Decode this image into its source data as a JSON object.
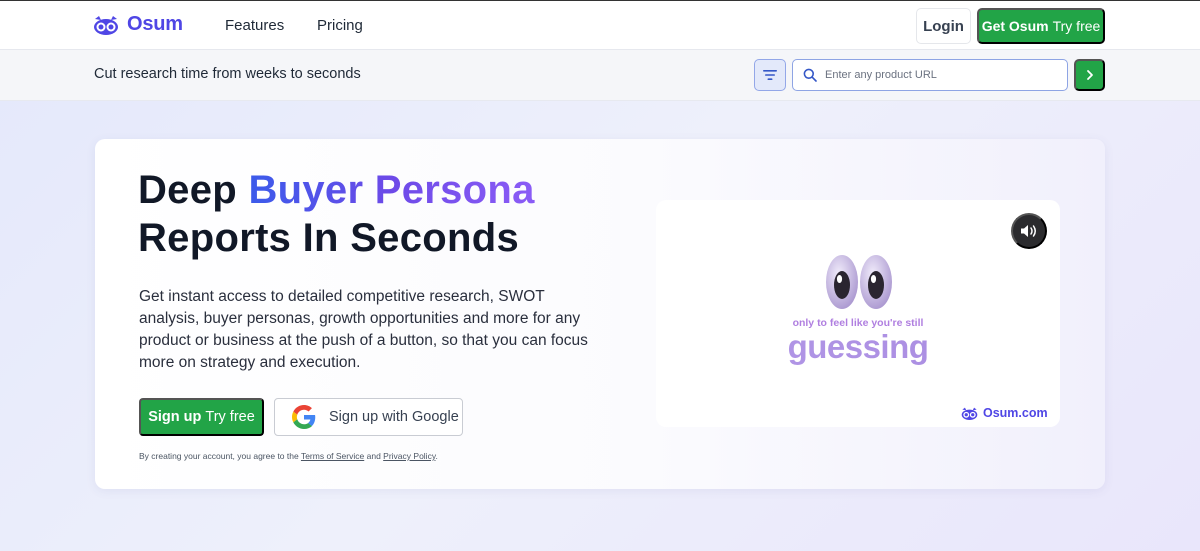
{
  "nav": {
    "brand": "Osum",
    "links": [
      "Features",
      "Pricing"
    ],
    "login_label": "Login",
    "cta_bold": "Get Osum",
    "cta_rest": "Try free"
  },
  "search": {
    "tagline": "Cut research time from weeks to seconds",
    "placeholder": "Enter any product URL"
  },
  "hero": {
    "headline_lead": "Deep",
    "headline_accent": "Buyer Persona",
    "headline_line2": "Reports In Seconds",
    "description": "Get instant access to detailed competitive research, SWOT analysis, buyer personas, growth opportunities and more for any product or business at the push of a button, so that you can focus more on strategy and execution.",
    "signup_bold": "Sign up",
    "signup_rest": "Try free",
    "google_label": "Sign up with Google",
    "legal_prefix": "By creating your account, you agree to the",
    "terms_label": "Terms of Service",
    "legal_and": "and",
    "privacy_label": "Privacy Policy",
    "legal_suffix": "."
  },
  "video": {
    "small_text": "only to feel like you're still",
    "big_text": "guessing",
    "brand_label": "Osum.com"
  },
  "colors": {
    "brand": "#4f46e5",
    "green": "#22a447",
    "accent_gradient_start": "#3b5bea",
    "accent_gradient_end": "#8b5cf6"
  },
  "icons": [
    "osum-owl-icon",
    "filter-icon",
    "search-icon",
    "chevron-right-icon",
    "google-icon",
    "volume-icon"
  ]
}
